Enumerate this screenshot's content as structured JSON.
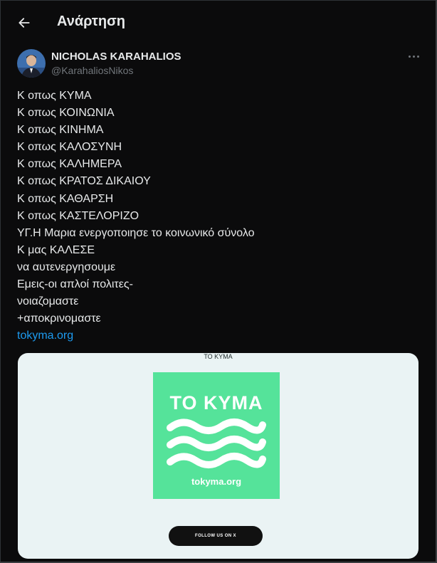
{
  "header": {
    "title": "Ανάρτηση",
    "back_icon": "arrow-left-icon"
  },
  "author": {
    "name": "NICHOLAS KARAHALIOS",
    "handle": "@KarahaliosNikos",
    "more_icon": "more-horizontal-icon"
  },
  "post": {
    "lines": [
      "Κ οπως ΚΥΜΑ",
      "Κ οπως ΚΟΙΝΩΝΙΑ",
      "Κ οπως ΚΙΝΗΜΑ",
      "Κ οπως ΚΑΛΟΣΥΝΗ",
      "Κ οπως ΚΑΛΗΜΕΡΑ",
      "Κ οπως ΚΡΑΤΟΣ ΔΙΚΑΙΟΥ",
      "Κ οπως ΚΑΘΑΡΣΗ",
      "Κ οπως ΚΑΣΤΕΛΟΡΙΖΟ",
      "ΥΓ.Η Μαρια ενεργοποιησε το κοινωνικό σύνολο",
      "Κ μας ΚΑΛΕΣΕ",
      "να αυτενεργησουμε",
      "Εμεις-οι απλοί πολιτες-",
      "νοιαζομαστε",
      "+αποκρινομαστε"
    ],
    "link": "tokyma.org"
  },
  "card": {
    "title": "ΤΟ ΚΥΜΑ",
    "logo_title": "ΤΟ ΚΥΜΑ",
    "logo_url": "tokyma.org",
    "follow_label": "FOLLOW US ON X",
    "brand_color": "#55e39a"
  },
  "colors": {
    "background": "#0b0b0c",
    "text": "#e7e9ea",
    "muted": "#71767b",
    "link": "#1d9bf0"
  }
}
